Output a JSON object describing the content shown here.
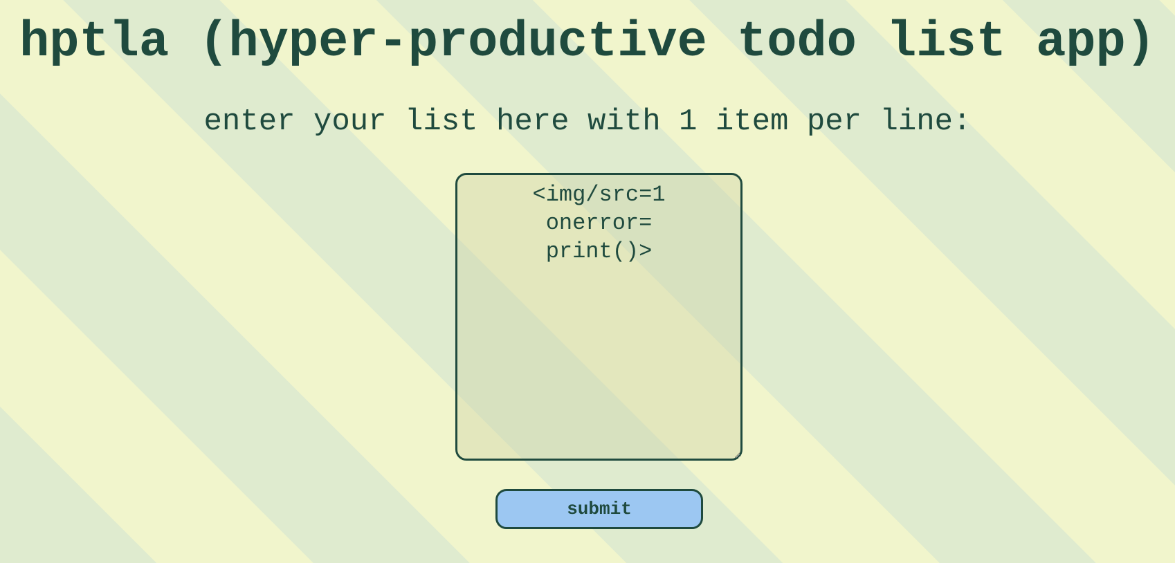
{
  "header": {
    "title": "hptla (hyper-productive todo list app)"
  },
  "form": {
    "instructions": "enter your list here with 1 item per line:",
    "list_value": "<img/src=1 onerror= print()>",
    "submit_label": "submit"
  },
  "colors": {
    "text": "#1f4a3e",
    "stripe_light": "#f1f5cc",
    "stripe_green": "#dfebcf",
    "button_bg": "#9cc7f2"
  }
}
